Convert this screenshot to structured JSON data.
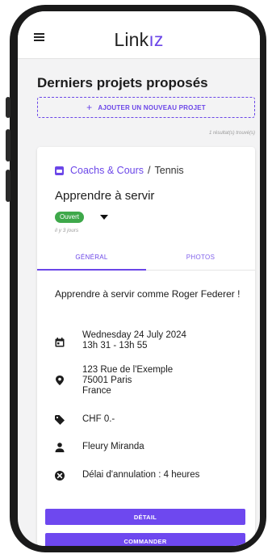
{
  "header": {
    "logo_main": "Link",
    "logo_tail": "ız",
    "menu_icon": "hamburger-menu-icon"
  },
  "page": {
    "title": "Derniers projets proposés",
    "add_button": "AJOUTER UN NOUVEAU PROJET",
    "add_icon": "plus-icon",
    "result_count": "1 résultat(s) trouvé(s)"
  },
  "project": {
    "category": "Coachs & Cours",
    "separator": "/",
    "subcategory": "Tennis",
    "title": "Apprendre à servir",
    "status": "Ouvert",
    "status_color": "#3ea84a",
    "posted_ago": "il y 3 jours",
    "tabs": [
      {
        "label": "GÉNÉRAL",
        "active": true
      },
      {
        "label": "PHOTOS",
        "active": false
      }
    ],
    "description": "Apprendre à servir comme Roger Federer !",
    "date_line1": "Wednesday 24 July 2024",
    "date_line2": "13h 31 - 13h 55",
    "address_line1": "123 Rue de l'Exemple",
    "address_line2": "75001 Paris",
    "address_line3": "France",
    "price": "CHF 0.-",
    "person": "Fleury Miranda",
    "cancellation": "Délai d'annulation : 4 heures",
    "detail_button": "DÉTAIL",
    "order_button": "COMMANDER"
  },
  "colors": {
    "accent": "#6b46e8",
    "status_open": "#3ea84a"
  }
}
